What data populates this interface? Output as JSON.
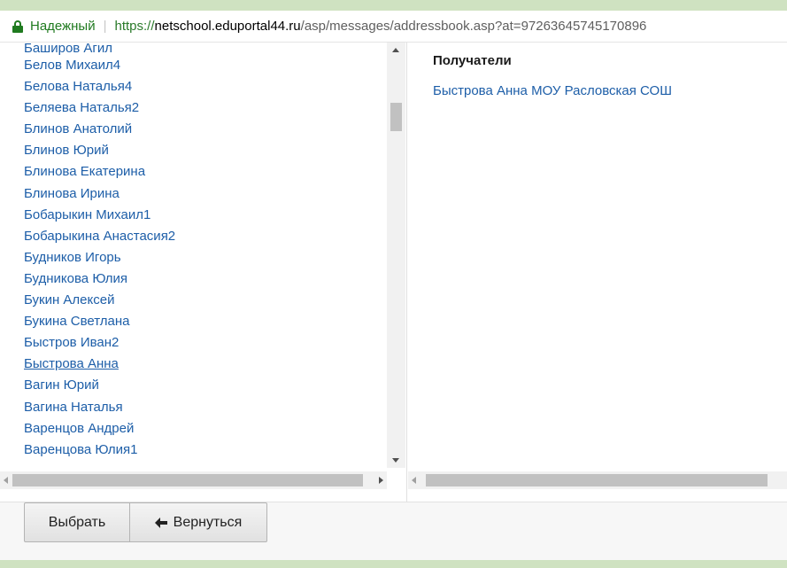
{
  "address_bar": {
    "secure_label": "Надежный",
    "url_protocol": "https://",
    "url_host": "netschool.eduportal44.ru",
    "url_path": "/asp/messages/addressbook.asp?at=97263645745170896"
  },
  "contacts": [
    {
      "label": "Баширов Агил"
    },
    {
      "label": "Белов Михаил4"
    },
    {
      "label": "Белова Наталья4"
    },
    {
      "label": "Беляева Наталья2"
    },
    {
      "label": "Блинов Анатолий"
    },
    {
      "label": "Блинов Юрий"
    },
    {
      "label": "Блинова Екатерина"
    },
    {
      "label": "Блинова Ирина"
    },
    {
      "label": "Бобарыкин Михаил1"
    },
    {
      "label": "Бобарыкина Анастасия2"
    },
    {
      "label": "Будников Игорь"
    },
    {
      "label": "Будникова Юлия"
    },
    {
      "label": "Букин Алексей"
    },
    {
      "label": "Букина Светлана"
    },
    {
      "label": "Быстров Иван2"
    },
    {
      "label": "Быстрова Анна"
    },
    {
      "label": "Вагин Юрий"
    },
    {
      "label": "Вагина Наталья"
    },
    {
      "label": "Варенцов Андрей"
    },
    {
      "label": "Варенцова Юлия1"
    }
  ],
  "recipients": {
    "title": "Получатели",
    "items": [
      "Быстрова Анна МОУ Расловская СОШ"
    ]
  },
  "buttons": {
    "select_label": "Выбрать",
    "back_label": "Вернуться"
  },
  "colors": {
    "link": "#1d5ea8",
    "secure": "#1f7a1f",
    "frame_green": "#cfe2c1"
  }
}
